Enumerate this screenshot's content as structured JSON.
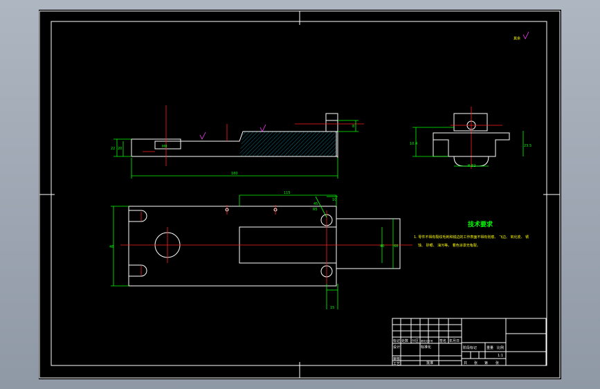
{
  "drawing": {
    "roughness_note": "其余",
    "side_view_dims": {
      "height_outer": "22",
      "height_inner": "20",
      "slot_width": "M8",
      "overall_length": "180",
      "step_height": "8"
    },
    "end_view_dims": {
      "left_height": "10.4",
      "right_height": "23.5",
      "bottom_width": "R 52"
    },
    "plan_view_dims": {
      "top_length": "115",
      "angle": "45",
      "radius": "R5",
      "right_offset": "10",
      "bottom_offset": "15",
      "overall_width": "48",
      "inner_width": "40",
      "slot_width": "68"
    },
    "tech_requirements": {
      "title": "技术要求",
      "line1": "1. 零件不得有裂纹毛刺和锐边的工作表面不得有划痕、 飞边、 氧化皮、 锈",
      "line2": "蚀、 砂眼、 油污等。 着色涂漆无龟裂。"
    },
    "title_block": {
      "row_labels": [
        "标记",
        "设计",
        "审核",
        "工艺"
      ],
      "header_cells": [
        "处数",
        "分区",
        "更改文件号",
        "签名",
        "年月日"
      ],
      "std_label": "标准化",
      "approve_label": "批准",
      "stage_label": "阶段标记",
      "weight_label": "重量",
      "scale_label": "比例",
      "scale_value": "1:1",
      "sheet_labels": [
        "共",
        "张",
        "第",
        "张"
      ]
    }
  }
}
